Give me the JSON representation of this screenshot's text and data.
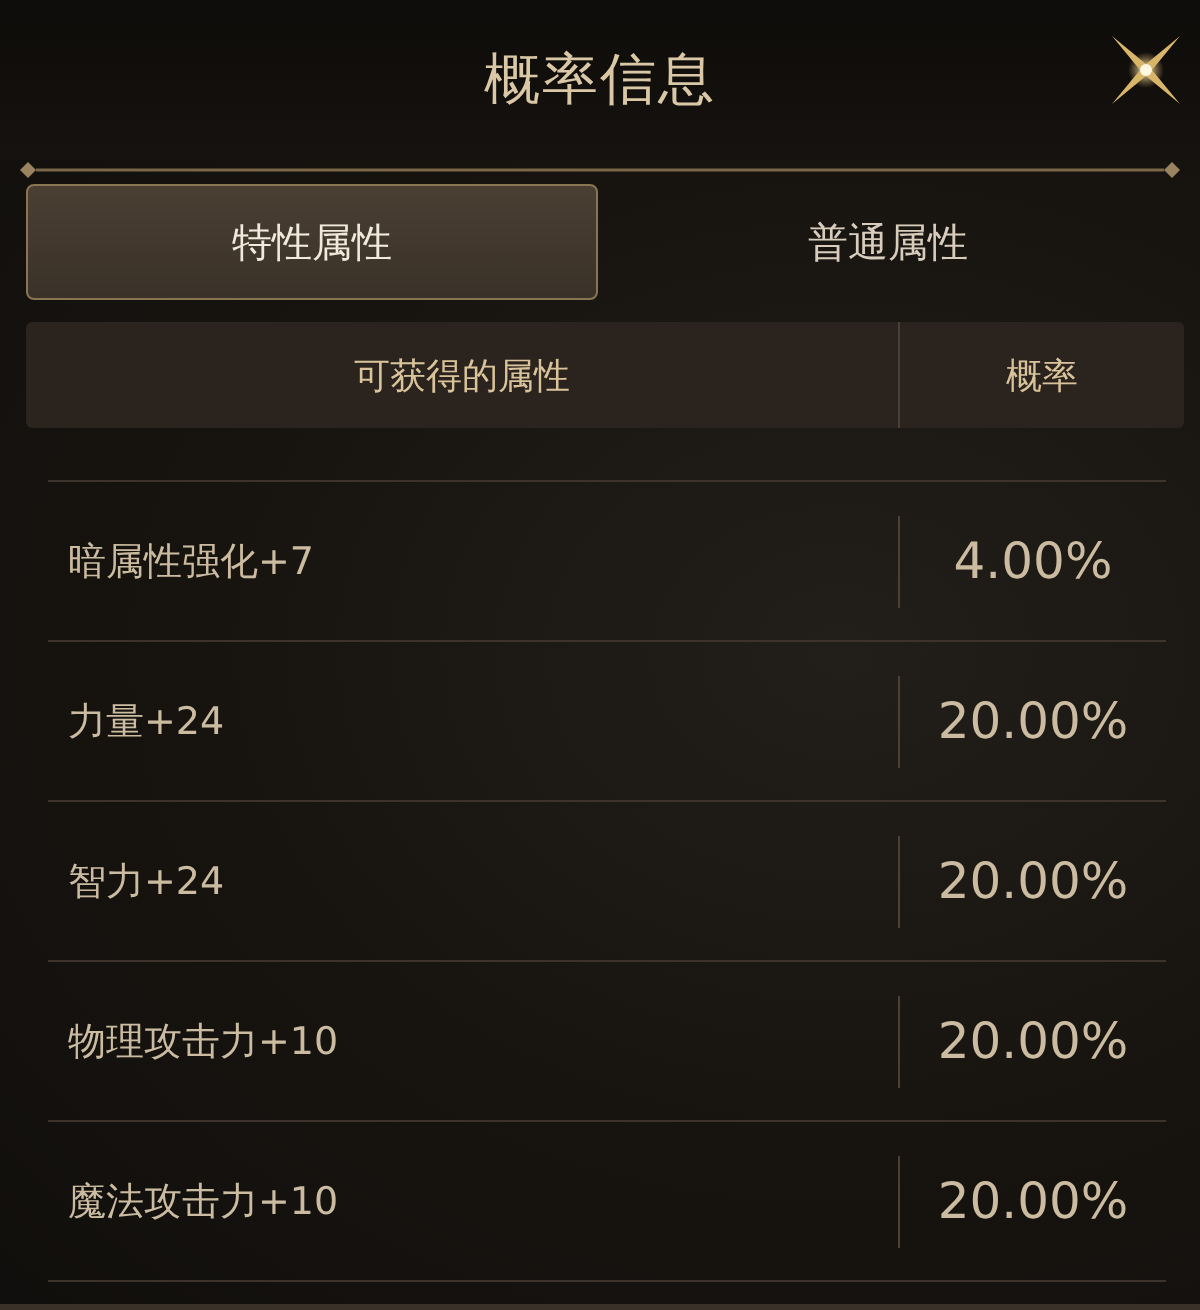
{
  "window": {
    "title": "概率信息"
  },
  "tabs": [
    {
      "label": "特性属性",
      "selected": true
    },
    {
      "label": "普通属性",
      "selected": false
    }
  ],
  "table": {
    "columns": [
      "可获得的属性",
      "概率"
    ],
    "rows": [
      {
        "attribute": "暗属性强化+7",
        "chance": "4.00%"
      },
      {
        "attribute": "力量+24",
        "chance": "20.00%"
      },
      {
        "attribute": "智力+24",
        "chance": "20.00%"
      },
      {
        "attribute": "物理攻击力+10",
        "chance": "20.00%"
      },
      {
        "attribute": "魔法攻击力+10",
        "chance": "20.00%"
      }
    ]
  }
}
